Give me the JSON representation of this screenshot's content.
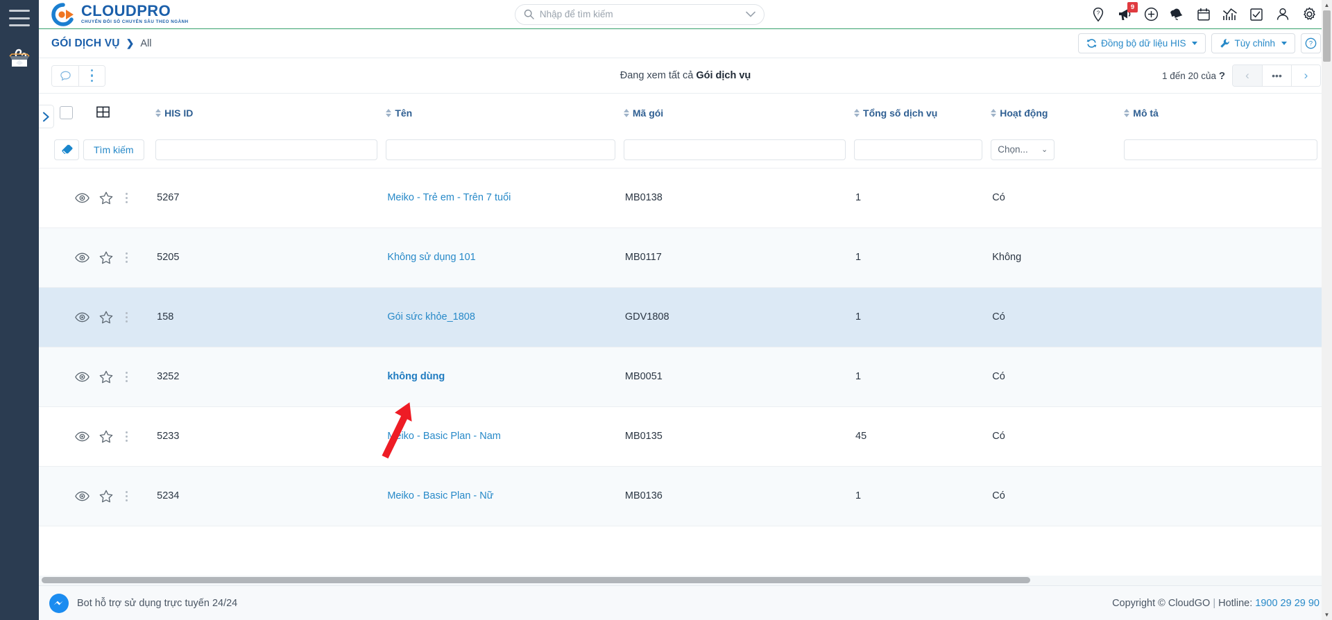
{
  "brand": {
    "name": "CLOUDPRO",
    "tagline": "CHUYỂN ĐỔI SỐ CHUYÊN SÂU THEO NGÀNH",
    "primary_color": "#1b5faa",
    "accent_color": "#ef7622",
    "link_color": "#2789c8",
    "green_rule": "#37a06b"
  },
  "topbar": {
    "menu_icon": "hamburger-icon",
    "rail_icon": "package-box-icon",
    "search": {
      "placeholder": "Nhập để tìm kiếm",
      "value": "",
      "icon": "search-icon",
      "dropdown_icon": "chevron-down-icon"
    },
    "icons": [
      {
        "name": "help-location-icon",
        "glyph": "?"
      },
      {
        "name": "announcement-megaphone-icon",
        "badge": "9"
      },
      {
        "name": "add-plus-icon"
      },
      {
        "name": "notification-bell-icon"
      },
      {
        "name": "calendar-icon"
      },
      {
        "name": "analytics-chart-icon"
      },
      {
        "name": "task-checkbox-icon"
      },
      {
        "name": "user-account-icon"
      },
      {
        "name": "settings-gear-icon"
      }
    ]
  },
  "breadcrumb": {
    "parent": "GÓI DỊCH VỤ",
    "separator": "❯",
    "current": "All"
  },
  "actions": {
    "sync_his": "Đồng bộ dữ liệu HIS",
    "customize": "Tùy chỉnh",
    "help": "?"
  },
  "listbar": {
    "chat_icon": "chat-bubble-icon",
    "more_icon": "more-vertical-icon",
    "viewing_prefix": "Đang xem tất cả",
    "viewing_entity": "Gói dịch vụ",
    "pagination": {
      "range_text": "1 đến 20 của",
      "total": "?",
      "prev": "‹",
      "more": "•••",
      "next": "›"
    }
  },
  "table": {
    "expander_icon": "chevron-right-icon",
    "select_all": "select-all-checkbox",
    "grid_icon": "grid-layout-icon",
    "columns": [
      {
        "key": "his_id",
        "label": "HIS ID"
      },
      {
        "key": "ten",
        "label": "Tên"
      },
      {
        "key": "ma_goi",
        "label": "Mã gói"
      },
      {
        "key": "tong_so_dich_vu",
        "label": "Tổng số dịch vụ"
      },
      {
        "key": "hoat_dong",
        "label": "Hoạt động"
      },
      {
        "key": "mo_ta",
        "label": "Mô tả"
      }
    ],
    "filters": {
      "clear_icon": "eraser-icon",
      "search_label": "Tìm kiếm",
      "his_id": "",
      "ten": "",
      "ma_goi": "",
      "tong_so_dich_vu": "",
      "hoat_dong_select": "Chọn...",
      "mo_ta": ""
    },
    "rows": [
      {
        "his_id": "5267",
        "ten": "Meiko - Trẻ em - Trên 7 tuổi",
        "ma_goi": "MB0138",
        "tong_so_dich_vu": "1",
        "hoat_dong": "Có",
        "mo_ta": "",
        "style": "white"
      },
      {
        "his_id": "5205",
        "ten": "Không sử dụng 101",
        "ma_goi": "MB0117",
        "tong_so_dich_vu": "1",
        "hoat_dong": "Không",
        "mo_ta": "",
        "style": "alt"
      },
      {
        "his_id": "158",
        "ten": "Gói sức khỏe_1808",
        "ma_goi": "GDV1808",
        "tong_so_dich_vu": "1",
        "hoat_dong": "Có",
        "mo_ta": "",
        "style": "selected"
      },
      {
        "his_id": "3252",
        "ten": "không dùng",
        "ma_goi": "MB0051",
        "tong_so_dich_vu": "1",
        "hoat_dong": "Có",
        "mo_ta": "",
        "style": "alt",
        "bold_link": true
      },
      {
        "his_id": "5233",
        "ten": "Meiko - Basic Plan - Nam",
        "ma_goi": "MB0135",
        "tong_so_dich_vu": "45",
        "hoat_dong": "Có",
        "mo_ta": "",
        "style": "white"
      },
      {
        "his_id": "5234",
        "ten": "Meiko - Basic Plan - Nữ",
        "ma_goi": "MB0136",
        "tong_so_dich_vu": "1",
        "hoat_dong": "Có",
        "mo_ta": "",
        "style": "alt"
      }
    ],
    "row_actions": {
      "view": "eye-icon",
      "favorite": "star-icon",
      "more": "more-vertical-icon"
    }
  },
  "footer": {
    "bot_icon": "messenger-bot-icon",
    "bot_text": "Bot hỗ trợ sử dụng trực tuyến 24/24",
    "copyright": "Copyright © CloudGO",
    "divider": "|",
    "hotline_label": "Hotline:",
    "hotline_number": "1900 29 29 90"
  },
  "annotation": {
    "arrow": "red-arrow-pointing-up-right",
    "color": "#ee1c25"
  }
}
